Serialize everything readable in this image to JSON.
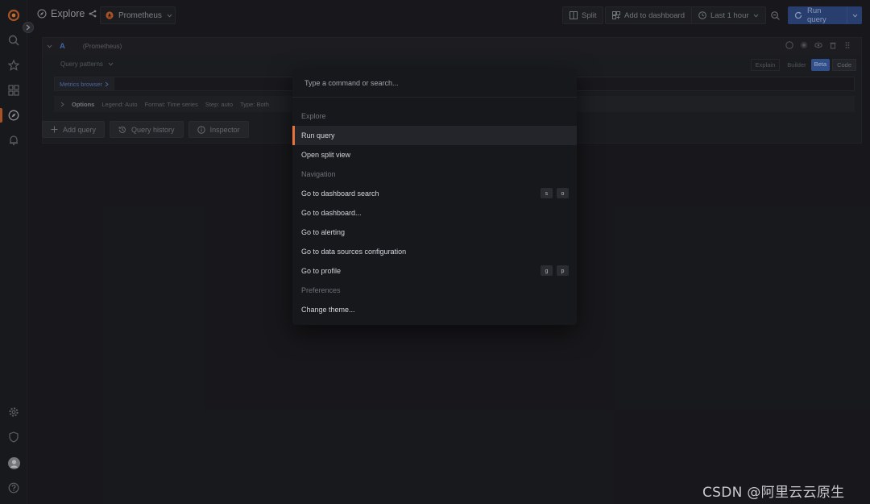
{
  "topbar": {
    "title": "Explore",
    "datasource": "Prometheus",
    "split_label": "Split",
    "add_to_dashboard_label": "Add to dashboard",
    "time_range": "Last 1 hour",
    "run_query_label": "Run query"
  },
  "query": {
    "letter": "A",
    "datasource": "(Prometheus)",
    "query_patterns": "Query patterns",
    "modes": {
      "explain": "Explain",
      "builder": "Builder",
      "beta": "Beta",
      "code": "Code"
    },
    "metrics_browser": "Metrics browser",
    "options": {
      "title": "Options",
      "legend": "Legend: Auto",
      "format": "Format: Time series",
      "step": "Step: auto",
      "type": "Type: Both"
    }
  },
  "actions": {
    "add_query": "Add query",
    "query_history": "Query history",
    "inspector": "Inspector"
  },
  "palette": {
    "placeholder": "Type a command or search...",
    "rows": [
      {
        "text": "Explore",
        "kind": "section"
      },
      {
        "text": "Run query",
        "kind": "item",
        "active": true
      },
      {
        "text": "Open split view",
        "kind": "item"
      },
      {
        "text": "Navigation",
        "kind": "section"
      },
      {
        "text": "Go to dashboard search",
        "kind": "item",
        "shortcut": [
          "s",
          "o"
        ]
      },
      {
        "text": "Go to dashboard...",
        "kind": "item"
      },
      {
        "text": "Go to alerting",
        "kind": "item"
      },
      {
        "text": "Go to data sources configuration",
        "kind": "item"
      },
      {
        "text": "Go to profile",
        "kind": "item",
        "shortcut": [
          "g",
          "p"
        ]
      },
      {
        "text": "Preferences",
        "kind": "section"
      },
      {
        "text": "Change theme...",
        "kind": "item"
      }
    ]
  },
  "sidebar": {
    "top_icons": [
      "grafana-logo-icon",
      "search-icon",
      "star-icon",
      "dashboards-icon",
      "compass-icon",
      "bell-icon"
    ],
    "bottom_icons": [
      "gear-icon",
      "shield-icon",
      "avatar",
      "help-icon"
    ]
  },
  "watermark": "CSDN @阿里云云原生",
  "colors": {
    "accent": "#e8743b",
    "primary": "#2e4a86",
    "background": "#1b1c20",
    "palette_bg": "#17181c"
  }
}
